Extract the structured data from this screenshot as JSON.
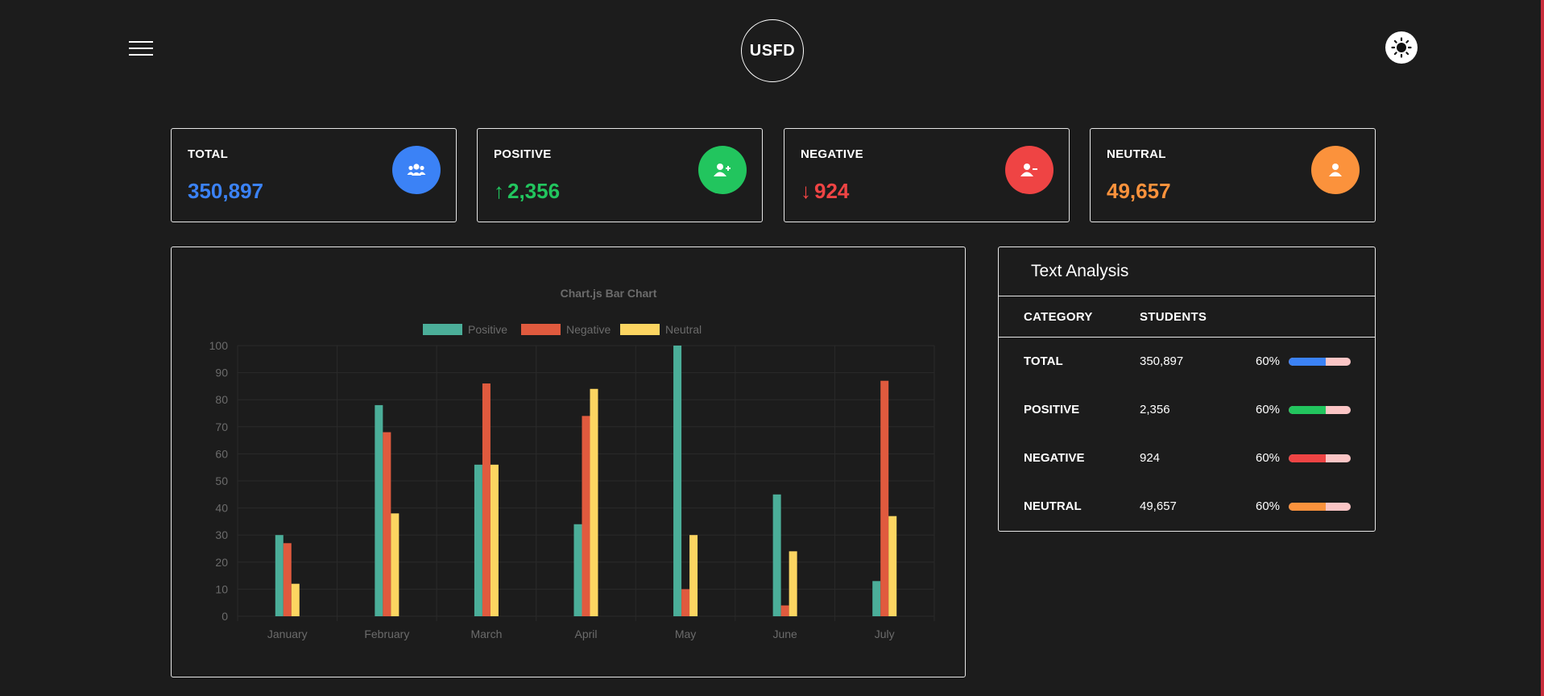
{
  "header": {
    "logo_text": "USFD",
    "menu_icon": "hamburger-menu-icon",
    "theme_icon": "sun-icon"
  },
  "stats": [
    {
      "title": "TOTAL",
      "value": "350,897",
      "color": "#3b82f6",
      "icon": "users-icon",
      "arrow": ""
    },
    {
      "title": "POSITIVE",
      "value": "2,356",
      "color": "#22c55e",
      "icon": "user-plus-icon",
      "arrow": "↑"
    },
    {
      "title": "NEGATIVE",
      "value": "924",
      "color": "#ef4444",
      "icon": "user-minus-icon",
      "arrow": "↓"
    },
    {
      "title": "NEUTRAL",
      "value": "49,657",
      "color": "#fb923c",
      "icon": "user-icon",
      "arrow": ""
    }
  ],
  "stat_value_colors": {
    "total": "#3b82f6",
    "positive": "#22c55e",
    "negative": "#ef4444",
    "neutral": "#fb923c"
  },
  "chart_data": {
    "type": "bar",
    "title": "Chart.js Bar Chart",
    "categories": [
      "January",
      "February",
      "March",
      "April",
      "May",
      "June",
      "July"
    ],
    "series": [
      {
        "name": "Positive",
        "color": "#4bae99",
        "values": [
          30,
          78,
          56,
          34,
          100,
          45,
          13
        ]
      },
      {
        "name": "Negative",
        "color": "#e05a3e",
        "values": [
          27,
          68,
          86,
          74,
          10,
          4,
          87
        ]
      },
      {
        "name": "Neutral",
        "color": "#fcd561",
        "values": [
          12,
          38,
          56,
          84,
          30,
          24,
          37
        ]
      }
    ],
    "ylim": [
      0,
      100
    ],
    "yticks": [
      0,
      10,
      20,
      30,
      40,
      50,
      60,
      70,
      80,
      90,
      100
    ],
    "grid": true,
    "legend": "top"
  },
  "analysis": {
    "title": "Text Analysis",
    "col_category": "CATEGORY",
    "col_students": "STUDENTS",
    "rows": [
      {
        "category": "TOTAL",
        "students": "350,897",
        "percent": "60%",
        "fill": 0.6,
        "color": "#3b82f6"
      },
      {
        "category": "POSITIVE",
        "students": "2,356",
        "percent": "60%",
        "fill": 0.6,
        "color": "#22c55e"
      },
      {
        "category": "NEGATIVE",
        "students": "924",
        "percent": "60%",
        "fill": 0.6,
        "color": "#ef4444"
      },
      {
        "category": "NEUTRAL",
        "students": "49,657",
        "percent": "60%",
        "fill": 0.6,
        "color": "#fb923c"
      }
    ]
  }
}
